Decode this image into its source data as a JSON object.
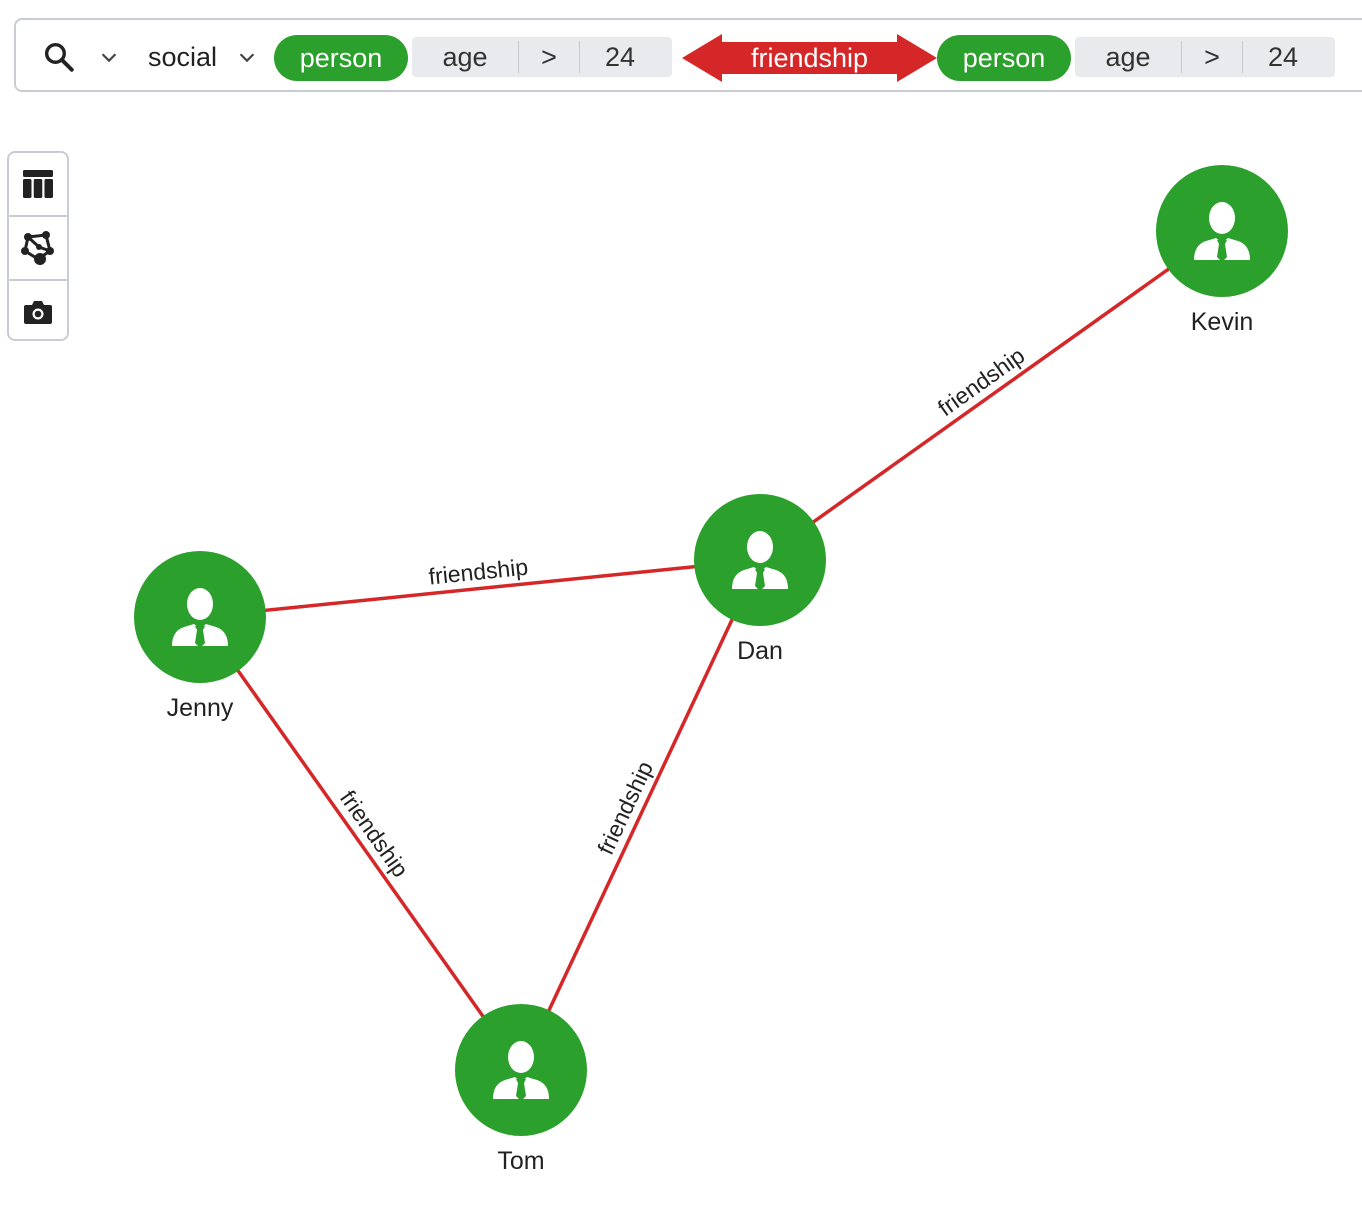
{
  "query": {
    "graph_name": "social",
    "source_node": {
      "label": "person",
      "field": "age",
      "operator": ">",
      "value": "24"
    },
    "edge": {
      "label": "friendship",
      "direction": "bidirectional"
    },
    "target_node": {
      "label": "person",
      "field": "age",
      "operator": ">",
      "value": "24"
    }
  },
  "toolbar": {
    "icons": [
      "table-view-icon",
      "graph-view-icon",
      "camera-icon"
    ]
  },
  "graph": {
    "node_color": "#2ca02c",
    "edge_color": "#d62728",
    "nodes": [
      {
        "id": "kevin",
        "label": "Kevin"
      },
      {
        "id": "dan",
        "label": "Dan"
      },
      {
        "id": "jenny",
        "label": "Jenny"
      },
      {
        "id": "tom",
        "label": "Tom"
      }
    ],
    "edges": [
      {
        "source": "dan",
        "target": "kevin",
        "label": "friendship"
      },
      {
        "source": "jenny",
        "target": "dan",
        "label": "friendship"
      },
      {
        "source": "jenny",
        "target": "tom",
        "label": "friendship"
      },
      {
        "source": "tom",
        "target": "dan",
        "label": "friendship"
      }
    ]
  }
}
